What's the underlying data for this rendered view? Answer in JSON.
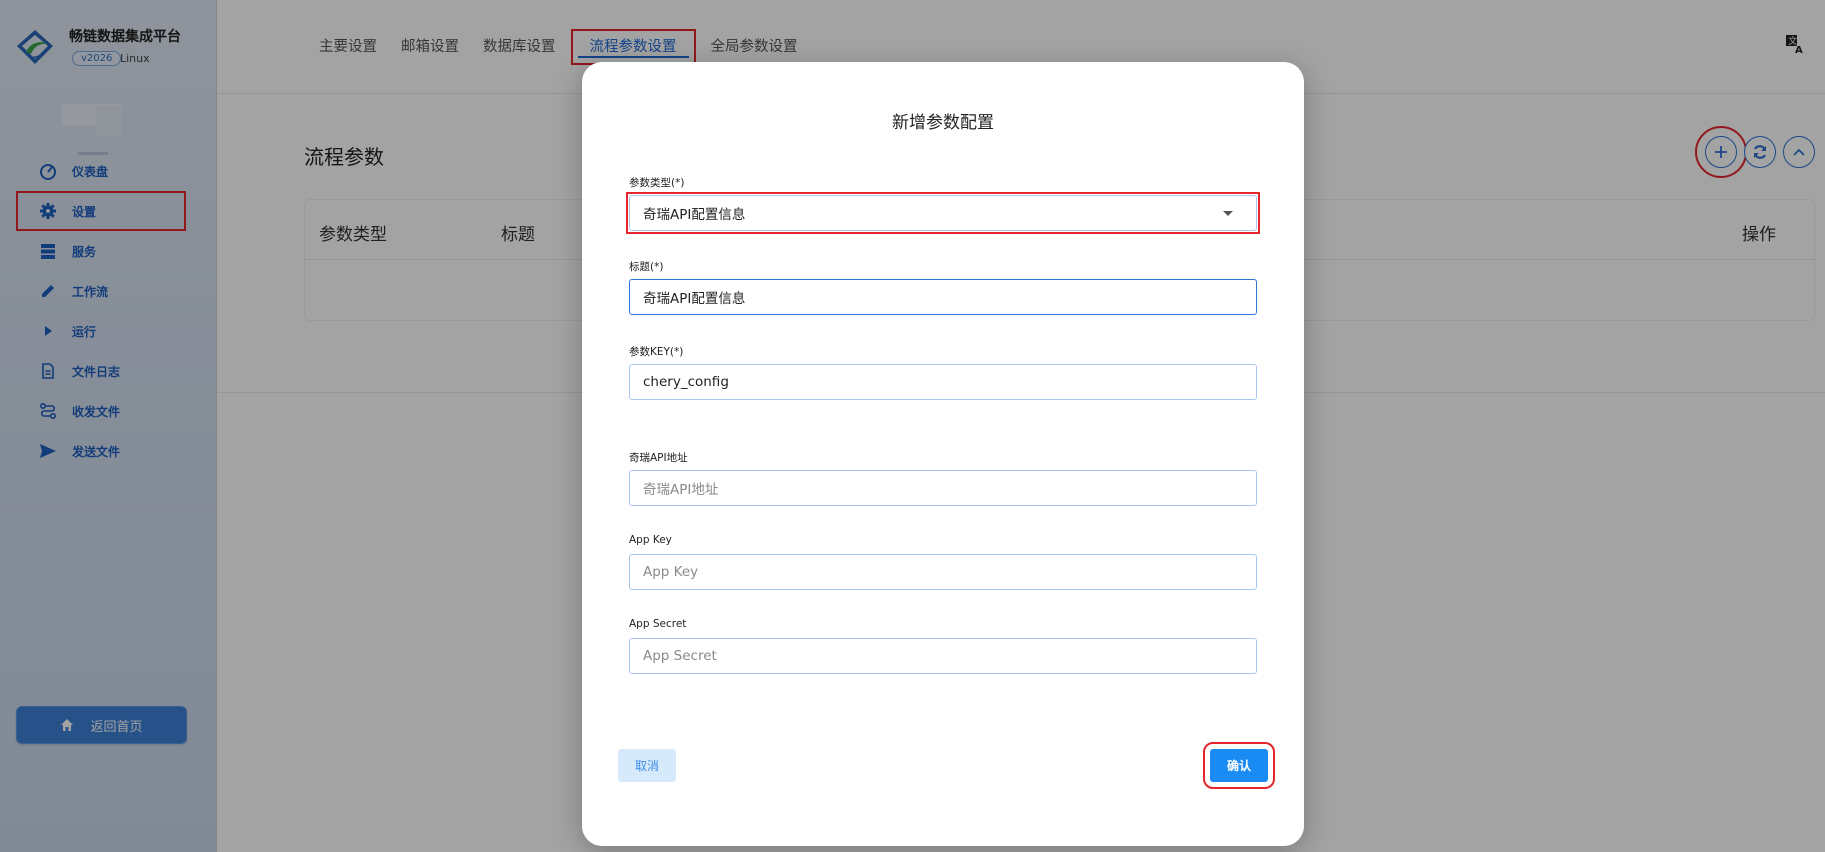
{
  "app": {
    "title": "畅链数据集成平台",
    "version": "v2026",
    "os": "Linux"
  },
  "sidebar": {
    "items": [
      {
        "label": "仪表盘",
        "icon": "gauge-icon"
      },
      {
        "label": "设置",
        "icon": "gear-icon",
        "active": true
      },
      {
        "label": "服务",
        "icon": "server-icon"
      },
      {
        "label": "工作流",
        "icon": "pencil-icon"
      },
      {
        "label": "运行",
        "icon": "play-icon"
      },
      {
        "label": "文件日志",
        "icon": "file-icon"
      },
      {
        "label": "收发文件",
        "icon": "route-icon"
      },
      {
        "label": "发送文件",
        "icon": "send-icon"
      }
    ],
    "home_button": "返回首页"
  },
  "tabs": [
    {
      "label": "主要设置"
    },
    {
      "label": "邮箱设置"
    },
    {
      "label": "数据库设置"
    },
    {
      "label": "流程参数设置",
      "active": true
    },
    {
      "label": "全局参数设置"
    }
  ],
  "section": {
    "title": "流程参数"
  },
  "table": {
    "columns": [
      "参数类型",
      "标题",
      "操作"
    ]
  },
  "modal": {
    "title": "新增参数配置",
    "fields": {
      "type": {
        "label": "参数类型(*)",
        "value": "奇瑞API配置信息"
      },
      "title": {
        "label": "标题(*)",
        "value": "奇瑞API配置信息"
      },
      "key": {
        "label": "参数KEY(*)",
        "value": "chery_config"
      },
      "api_url": {
        "label": "奇瑞API地址",
        "placeholder": "奇瑞API地址"
      },
      "app_key": {
        "label": "App Key",
        "placeholder": "App Key"
      },
      "app_secret": {
        "label": "App Secret",
        "placeholder": "App Secret"
      }
    },
    "cancel_label": "取消",
    "confirm_label": "确认"
  },
  "colors": {
    "accent": "#1f6ad6",
    "confirm": "#1b8bf4",
    "highlight": "#e5262d"
  }
}
